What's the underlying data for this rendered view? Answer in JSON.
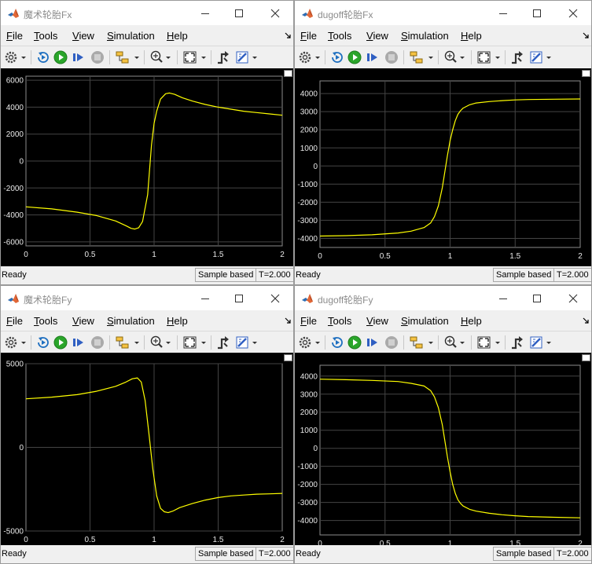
{
  "menu": {
    "file": {
      "u": "F",
      "rest": "ile"
    },
    "tools": {
      "u": "T",
      "rest": "ools"
    },
    "view": {
      "u": "V",
      "rest": "iew"
    },
    "simulation": {
      "u": "S",
      "rest": "imulation"
    },
    "help": {
      "u": "H",
      "rest": "elp"
    }
  },
  "icons": [
    "matlab-scope-icon",
    "minimize-icon",
    "maximize-icon",
    "close-icon",
    "gear-icon",
    "rewind-icon",
    "run-icon",
    "step-forward-icon",
    "stop-icon",
    "highlight-block-icon",
    "zoom-icon",
    "fit-to-view-icon",
    "triggers-icon",
    "signal-stats-icon"
  ],
  "windows": [
    {
      "title": "魔术轮胎Fx",
      "status": {
        "ready": "Ready",
        "mode": "Sample based",
        "time": "T=2.000"
      },
      "chart_data": {
        "type": "line",
        "xlim": [
          0,
          2
        ],
        "ylim": [
          -6300,
          6300
        ],
        "xticks": [
          0,
          0.5,
          1,
          1.5,
          2
        ],
        "yticks": [
          -6000,
          -4000,
          -2000,
          0,
          2000,
          4000,
          6000
        ],
        "line_color": "#ffff00",
        "grid": true,
        "series": [
          {
            "x": [
              0,
              0.2,
              0.4,
              0.55,
              0.7,
              0.78,
              0.82,
              0.85,
              0.88,
              0.91,
              0.95,
              0.98,
              1.0,
              1.02,
              1.05,
              1.09,
              1.12,
              1.16,
              1.22,
              1.3,
              1.4,
              1.5,
              1.6,
              1.7,
              1.8,
              1.9,
              2.0
            ],
            "y": [
              -3400,
              -3550,
              -3800,
              -4050,
              -4450,
              -4800,
              -5000,
              -5050,
              -4950,
              -4500,
              -2500,
              1200,
              2800,
              3700,
              4600,
              5000,
              5050,
              4950,
              4700,
              4450,
              4200,
              4000,
              3850,
              3700,
              3600,
              3500,
              3400
            ]
          }
        ]
      }
    },
    {
      "title": "dugoff轮胎Fx",
      "status": {
        "ready": "Ready",
        "mode": "Sample based",
        "time": "T=2.000"
      },
      "chart_data": {
        "type": "line",
        "xlim": [
          0,
          2
        ],
        "ylim": [
          -4500,
          4700
        ],
        "xticks": [
          0,
          0.5,
          1,
          1.5,
          2
        ],
        "yticks": [
          -4000,
          -3000,
          -2000,
          -1000,
          0,
          1000,
          2000,
          3000,
          4000
        ],
        "line_color": "#ffff00",
        "grid": true,
        "series": [
          {
            "x": [
              0,
              0.2,
              0.4,
              0.6,
              0.7,
              0.8,
              0.85,
              0.88,
              0.91,
              0.94,
              0.96,
              0.98,
              1.0,
              1.02,
              1.04,
              1.06,
              1.08,
              1.1,
              1.15,
              1.2,
              1.3,
              1.4,
              1.5,
              1.6,
              1.8,
              2.0
            ],
            "y": [
              -3870,
              -3850,
              -3800,
              -3700,
              -3600,
              -3400,
              -3150,
              -2800,
              -2200,
              -1200,
              -300,
              600,
              1400,
              2000,
              2500,
              2850,
              3050,
              3200,
              3380,
              3480,
              3560,
              3610,
              3650,
              3670,
              3690,
              3700
            ]
          }
        ]
      }
    },
    {
      "title": "魔术轮胎Fy",
      "status": {
        "ready": "Ready",
        "mode": "Sample based",
        "time": "T=2.000"
      },
      "chart_data": {
        "type": "line",
        "xlim": [
          0,
          2
        ],
        "ylim": [
          -5000,
          5000
        ],
        "xticks": [
          0,
          0.5,
          1,
          1.5,
          2
        ],
        "yticks": [
          -5000,
          0,
          5000
        ],
        "line_color": "#ffff00",
        "grid": true,
        "series": [
          {
            "x": [
              0,
              0.2,
              0.4,
              0.55,
              0.7,
              0.78,
              0.83,
              0.87,
              0.9,
              0.93,
              0.96,
              0.99,
              1.02,
              1.05,
              1.08,
              1.11,
              1.15,
              1.2,
              1.3,
              1.4,
              1.5,
              1.6,
              1.7,
              1.8,
              1.9,
              2.0
            ],
            "y": [
              2900,
              3000,
              3150,
              3350,
              3650,
              3900,
              4100,
              4150,
              3900,
              2800,
              800,
              -1300,
              -2900,
              -3650,
              -3850,
              -3900,
              -3800,
              -3600,
              -3350,
              -3150,
              -3000,
              -2900,
              -2850,
              -2800,
              -2780,
              -2750
            ]
          }
        ]
      }
    },
    {
      "title": "dugoff轮胎Fy",
      "status": {
        "ready": "Ready",
        "mode": "Sample based",
        "time": "T=2.000"
      },
      "chart_data": {
        "type": "line",
        "xlim": [
          0,
          2
        ],
        "ylim": [
          -4800,
          4600
        ],
        "xticks": [
          0,
          0.5,
          1,
          1.5,
          2
        ],
        "yticks": [
          -4000,
          -3000,
          -2000,
          -1000,
          0,
          1000,
          2000,
          3000,
          4000
        ],
        "line_color": "#ffff00",
        "grid": true,
        "series": [
          {
            "x": [
              0,
              0.2,
              0.4,
              0.6,
              0.7,
              0.8,
              0.85,
              0.88,
              0.91,
              0.94,
              0.96,
              0.98,
              1.0,
              1.02,
              1.04,
              1.06,
              1.08,
              1.1,
              1.15,
              1.2,
              1.3,
              1.4,
              1.5,
              1.6,
              1.8,
              2.0
            ],
            "y": [
              3830,
              3800,
              3760,
              3700,
              3600,
              3450,
              3200,
              2850,
              2250,
              1300,
              400,
              -500,
              -1300,
              -2000,
              -2500,
              -2850,
              -3050,
              -3200,
              -3380,
              -3480,
              -3600,
              -3680,
              -3740,
              -3780,
              -3820,
              -3850
            ]
          }
        ]
      }
    }
  ]
}
